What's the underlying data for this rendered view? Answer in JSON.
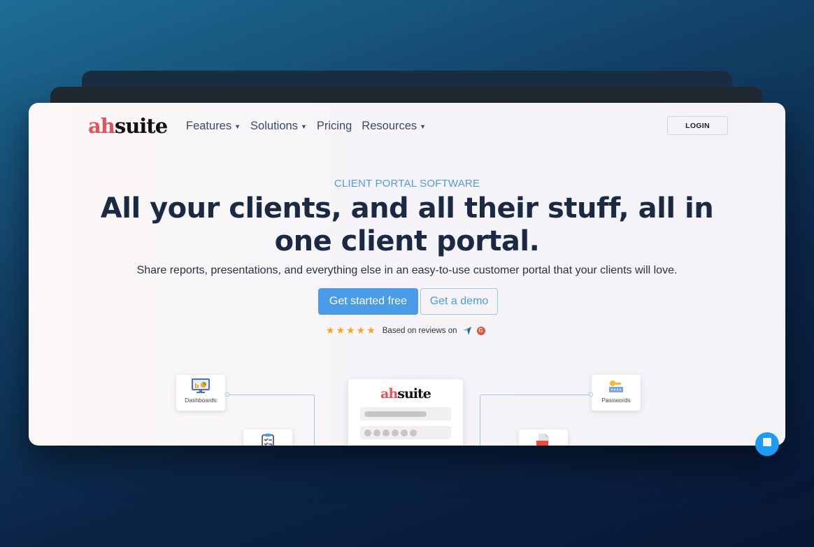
{
  "brand": {
    "logo_prefix": "ah",
    "logo_suffix": "suite",
    "accent": "#4a9be8",
    "logo_red": "#e8505b"
  },
  "nav": {
    "items": [
      {
        "label": "Features",
        "has_dropdown": true
      },
      {
        "label": "Solutions",
        "has_dropdown": true
      },
      {
        "label": "Pricing",
        "has_dropdown": false
      },
      {
        "label": "Resources",
        "has_dropdown": true
      }
    ],
    "login_label": "LOGIN"
  },
  "hero": {
    "eyebrow": "CLIENT PORTAL SOFTWARE",
    "headline_line1": "All your clients, and all their stuff, all in",
    "headline_line2": "one client portal.",
    "subhead": "Share reports, presentations, and everything else in an easy-to-use customer portal that your clients will love.",
    "cta_primary": "Get started free",
    "cta_secondary": "Get a demo",
    "stars": "★★★★★",
    "rating": 5,
    "reviews_text": "Based on reviews on",
    "review_sites": [
      "capterra-icon",
      "g2-icon"
    ]
  },
  "illustration": {
    "cards": [
      {
        "label": "Dashboards",
        "icon": "dashboard-monitor-icon"
      },
      {
        "label": "Passwords",
        "icon": "key-password-icon"
      },
      {
        "label": "",
        "icon": "checklist-clipboard-icon"
      },
      {
        "label": "",
        "icon": "pdf-file-icon"
      }
    ],
    "portal_logo_prefix": "ah",
    "portal_logo_suffix": "suite"
  },
  "chat": {
    "icon": "chat-widget-icon"
  }
}
